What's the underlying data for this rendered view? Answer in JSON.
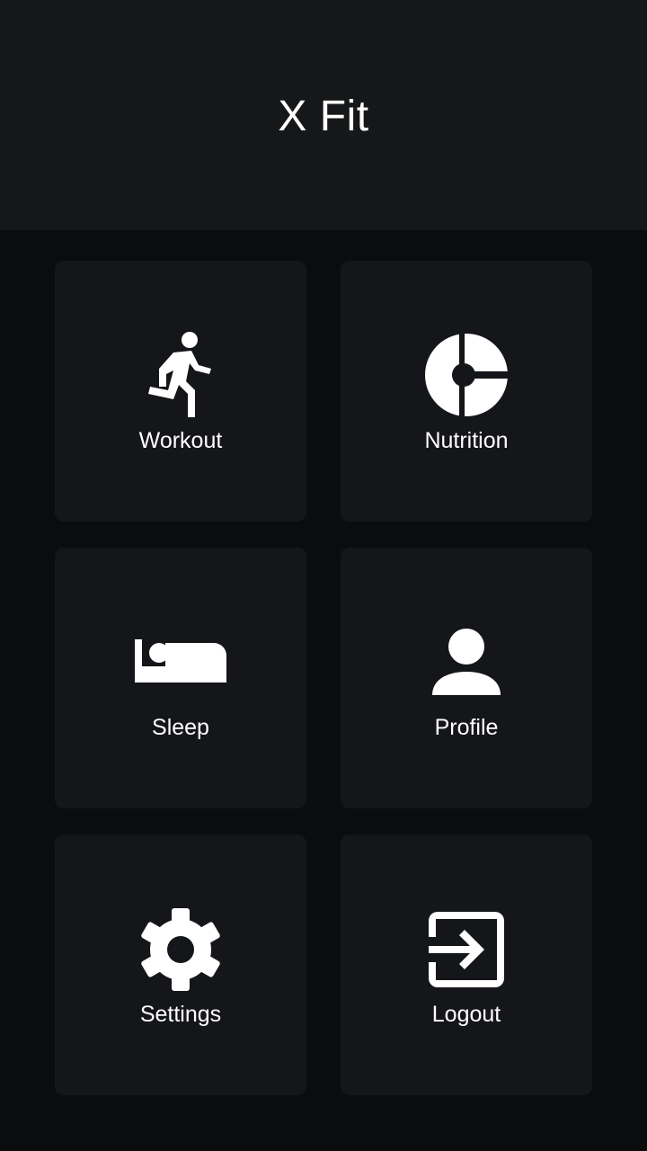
{
  "header": {
    "title": "X Fit"
  },
  "colors": {
    "background": "#0b0c0e",
    "header_background": "#161719",
    "tile_background": "#151619",
    "foreground": "#ffffff"
  },
  "menu": {
    "items": [
      {
        "label": "Workout",
        "icon": "running-person-icon"
      },
      {
        "label": "Nutrition",
        "icon": "nutrition-plate-icon"
      },
      {
        "label": "Sleep",
        "icon": "bed-icon"
      },
      {
        "label": "Profile",
        "icon": "person-icon"
      },
      {
        "label": "Settings",
        "icon": "gear-icon"
      },
      {
        "label": "Logout",
        "icon": "logout-icon"
      }
    ]
  }
}
